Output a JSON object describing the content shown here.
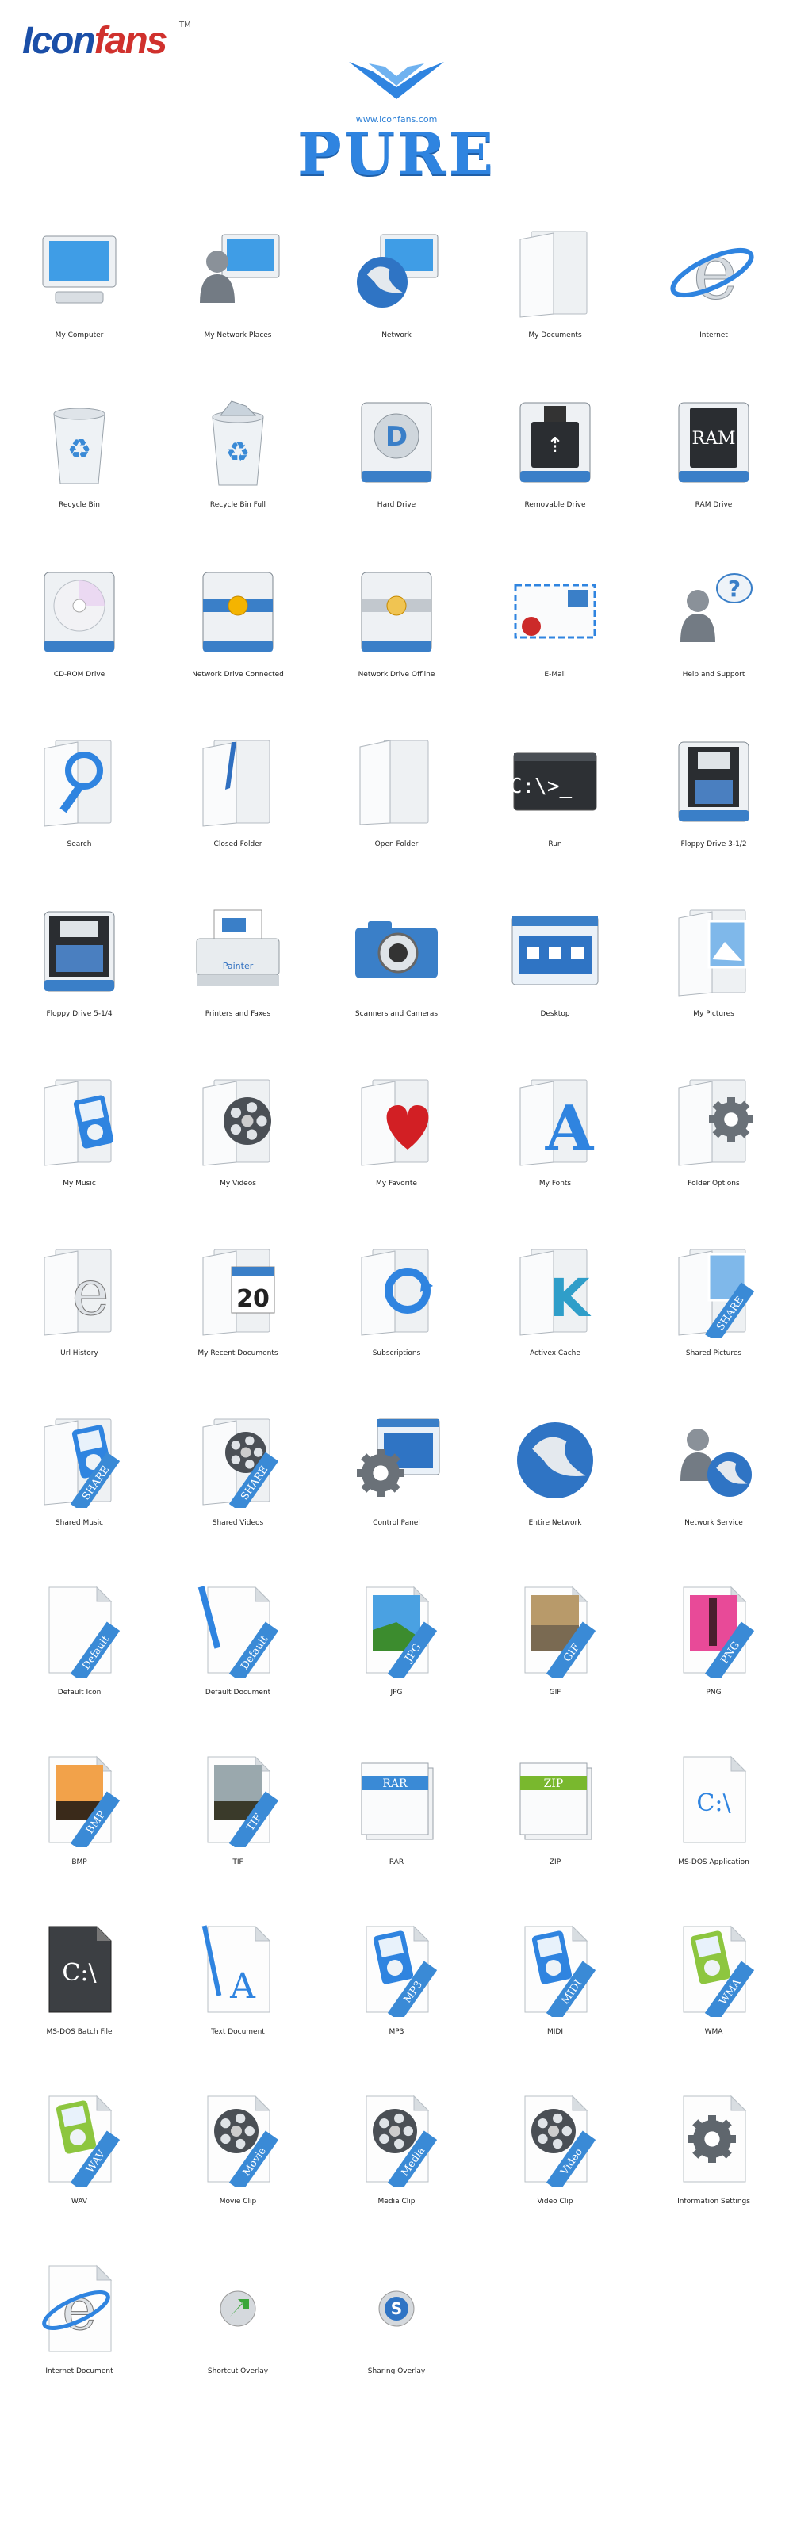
{
  "header": {
    "logo_text_a": "Icon",
    "logo_text_b": "fans",
    "logo_tm": "TM",
    "brand_url": "www.iconfans.com",
    "brand_title": "PURE"
  },
  "colors": {
    "accent": "#2f84e0",
    "ribbon": "#3a8ad6",
    "dark": "#333333"
  },
  "icons": [
    {
      "label": "My Computer",
      "icon": "monitor-icon"
    },
    {
      "label": "My Network Places",
      "icon": "user-monitor-icon"
    },
    {
      "label": "Network",
      "icon": "globe-monitor-icon"
    },
    {
      "label": "My Documents",
      "icon": "folder-icon"
    },
    {
      "label": "Internet",
      "icon": "ie-icon"
    },
    {
      "label": "Recycle Bin",
      "icon": "recycle-empty-icon"
    },
    {
      "label": "Recycle Bin Full",
      "icon": "recycle-full-icon"
    },
    {
      "label": "Hard Drive",
      "icon": "hard-drive-icon"
    },
    {
      "label": "Removable Drive",
      "icon": "usb-drive-icon"
    },
    {
      "label": "RAM Drive",
      "icon": "ram-drive-icon"
    },
    {
      "label": "CD-ROM Drive",
      "icon": "cdrom-icon"
    },
    {
      "label": "Network Drive Connected",
      "icon": "network-drive-on-icon"
    },
    {
      "label": "Network Drive Offline",
      "icon": "network-drive-off-icon"
    },
    {
      "label": "E-Mail",
      "icon": "mail-icon"
    },
    {
      "label": "Help and Support",
      "icon": "help-icon"
    },
    {
      "label": "Search",
      "icon": "search-folder-icon"
    },
    {
      "label": "Closed Folder",
      "icon": "closed-folder-icon"
    },
    {
      "label": "Open Folder",
      "icon": "open-folder-icon"
    },
    {
      "label": "Run",
      "icon": "run-icon"
    },
    {
      "label": "Floppy Drive 3-1/2",
      "icon": "floppy-35-icon"
    },
    {
      "label": "Floppy Drive 5-1/4",
      "icon": "floppy-525-icon"
    },
    {
      "label": "Printers and Faxes",
      "icon": "printer-icon"
    },
    {
      "label": "Scanners and Cameras",
      "icon": "camera-icon"
    },
    {
      "label": "Desktop",
      "icon": "desktop-icon"
    },
    {
      "label": "My Pictures",
      "icon": "pictures-folder-icon"
    },
    {
      "label": "My Music",
      "icon": "music-folder-icon"
    },
    {
      "label": "My Videos",
      "icon": "videos-folder-icon"
    },
    {
      "label": "My Favorite",
      "icon": "favorite-folder-icon"
    },
    {
      "label": "My Fonts",
      "icon": "fonts-folder-icon"
    },
    {
      "label": "Folder Options",
      "icon": "folder-options-icon"
    },
    {
      "label": "Url History",
      "icon": "history-folder-icon"
    },
    {
      "label": "My Recent Documents",
      "icon": "recent-folder-icon"
    },
    {
      "label": "Subscriptions",
      "icon": "subscriptions-folder-icon"
    },
    {
      "label": "Activex Cache",
      "icon": "activex-folder-icon"
    },
    {
      "label": "Shared Pictures",
      "icon": "shared-pictures-icon"
    },
    {
      "label": "Shared Music",
      "icon": "shared-music-icon"
    },
    {
      "label": "Shared Videos",
      "icon": "shared-videos-icon"
    },
    {
      "label": "Control Panel",
      "icon": "control-panel-icon"
    },
    {
      "label": "Entire Network",
      "icon": "entire-network-icon"
    },
    {
      "label": "Network Service",
      "icon": "network-service-icon"
    },
    {
      "label": "Default Icon",
      "icon": "default-file-icon",
      "ribbon": "Default"
    },
    {
      "label": "Default Document",
      "icon": "default-doc-icon",
      "ribbon": "Default"
    },
    {
      "label": "JPG",
      "icon": "jpg-file-icon",
      "ribbon": "JPG"
    },
    {
      "label": "GIF",
      "icon": "gif-file-icon",
      "ribbon": "GIF"
    },
    {
      "label": "PNG",
      "icon": "png-file-icon",
      "ribbon": "PNG"
    },
    {
      "label": "BMP",
      "icon": "bmp-file-icon",
      "ribbon": "BMP"
    },
    {
      "label": "TIF",
      "icon": "tif-file-icon",
      "ribbon": "TIF"
    },
    {
      "label": "RAR",
      "icon": "rar-file-icon",
      "ribbon": "RAR"
    },
    {
      "label": "ZIP",
      "icon": "zip-file-icon",
      "ribbon": "ZIP"
    },
    {
      "label": "MS-DOS Application",
      "icon": "dos-app-icon",
      "glyph": "C:\\"
    },
    {
      "label": "MS-DOS Batch File",
      "icon": "dos-batch-icon",
      "glyph": "C:\\"
    },
    {
      "label": "Text Document",
      "icon": "text-doc-icon",
      "glyph": "A"
    },
    {
      "label": "MP3",
      "icon": "mp3-file-icon",
      "ribbon": "MP3"
    },
    {
      "label": "MIDI",
      "icon": "midi-file-icon",
      "ribbon": "MIDI"
    },
    {
      "label": "WMA",
      "icon": "wma-file-icon",
      "ribbon": "WMA"
    },
    {
      "label": "WAV",
      "icon": "wav-file-icon",
      "ribbon": "WAV"
    },
    {
      "label": "Movie Clip",
      "icon": "movie-clip-icon",
      "ribbon": "Movie"
    },
    {
      "label": "Media Clip",
      "icon": "media-clip-icon",
      "ribbon": "Media"
    },
    {
      "label": "Video Clip",
      "icon": "video-clip-icon",
      "ribbon": "Video"
    },
    {
      "label": "Information Settings",
      "icon": "info-settings-icon"
    },
    {
      "label": "Internet Document",
      "icon": "internet-doc-icon"
    },
    {
      "label": "Shortcut Overlay",
      "icon": "shortcut-overlay-icon"
    },
    {
      "label": "Sharing Overlay",
      "icon": "sharing-overlay-icon",
      "glyph": "S"
    }
  ]
}
